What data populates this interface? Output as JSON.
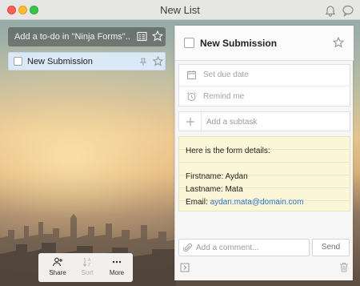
{
  "window": {
    "title": "New List"
  },
  "toolbar_icons": [
    "bell-icon",
    "chat-bubble-icon"
  ],
  "add_todo": {
    "placeholder": "Add a to-do in \"Ninja Forms\"..."
  },
  "list": {
    "items": [
      {
        "label": "New Submission",
        "starred": false,
        "selected": true
      }
    ]
  },
  "bottom_toolbar": {
    "share_label": "Share",
    "sort_label": "Sort",
    "more_label": "More"
  },
  "detail": {
    "title": "New Submission",
    "due_date_label": "Set due date",
    "reminder_label": "Remind me",
    "subtask_placeholder": "Add a subtask",
    "note": {
      "heading": "Here is the form details:",
      "firstname": "Firstname: Aydan",
      "lastname": "Lastname: Mata",
      "email_label": "Email: ",
      "email_value": "aydan.mata@domain.com"
    },
    "comment_placeholder": "Add a comment...",
    "send_label": "Send"
  },
  "colors": {
    "selection": "#dbe8f6",
    "note_background": "#fcf6d9",
    "link": "#2a76c6"
  }
}
